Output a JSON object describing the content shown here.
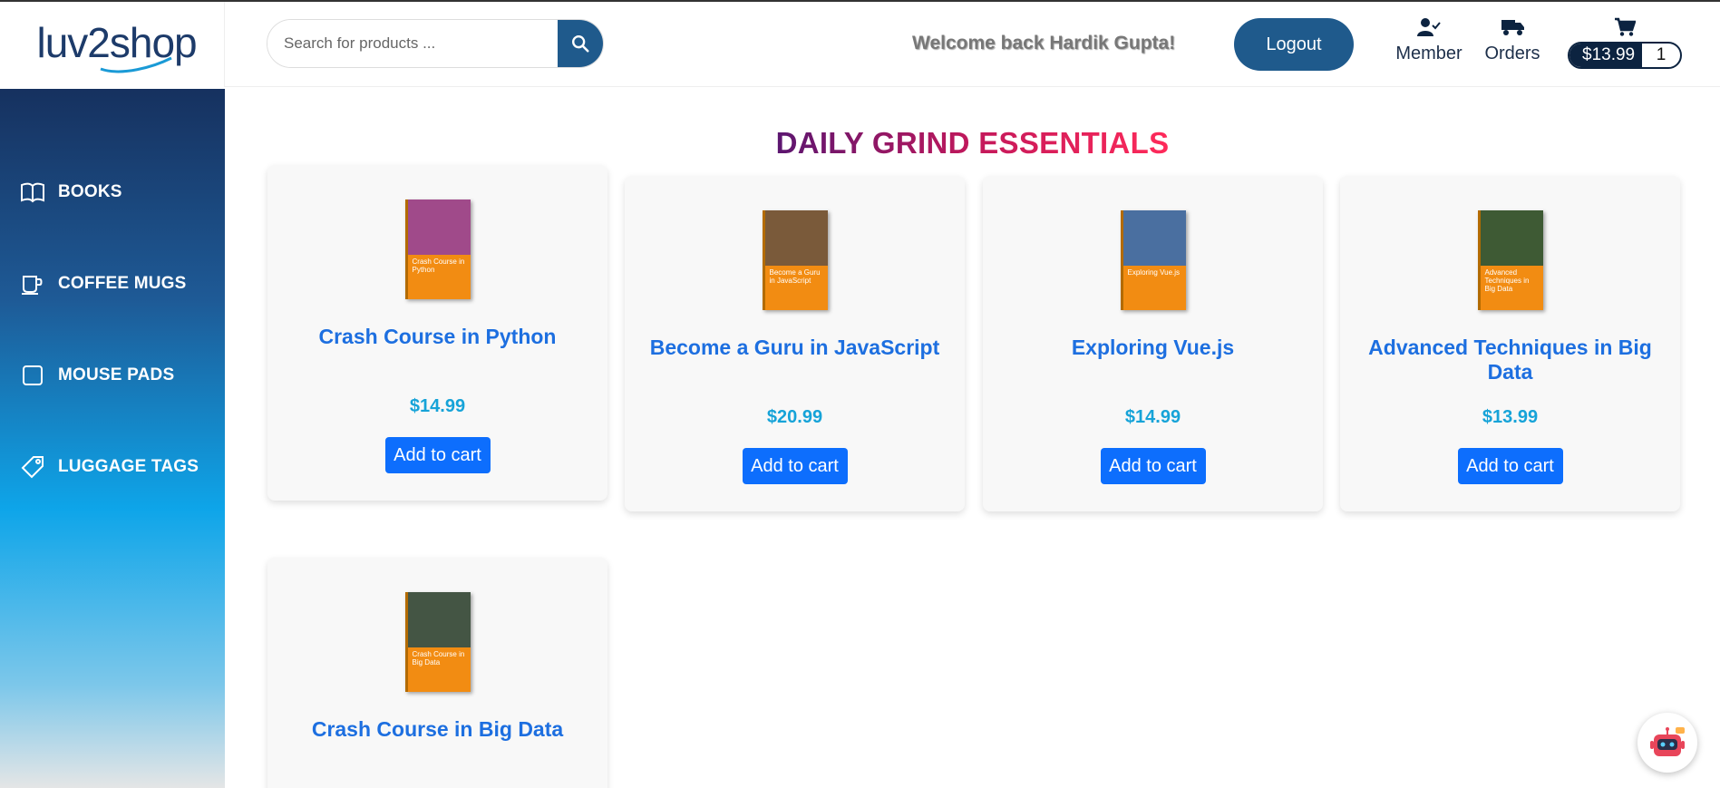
{
  "brand": {
    "logo_text": "luv2shop"
  },
  "search": {
    "placeholder": "Search for products ..."
  },
  "header": {
    "welcome": "Welcome back Hardik Gupta!",
    "logout_label": "Logout",
    "member_label": "Member",
    "orders_label": "Orders",
    "cart_total": "$13.99",
    "cart_count": "1"
  },
  "sidebar": {
    "items": [
      {
        "label": "BOOKS",
        "icon": "book-icon"
      },
      {
        "label": "COFFEE MUGS",
        "icon": "mug-icon"
      },
      {
        "label": "MOUSE PADS",
        "icon": "square-icon"
      },
      {
        "label": "LUGGAGE TAGS",
        "icon": "tag-icon"
      }
    ]
  },
  "main": {
    "title": "DAILY GRIND ESSENTIALS",
    "add_label": "Add to cart",
    "products": [
      {
        "name": "Crash Course in Python",
        "price": "$14.99",
        "cover_text": "Crash Course in Python",
        "cover_color": "#a04a8a"
      },
      {
        "name": "Become a Guru in JavaScript",
        "price": "$20.99",
        "cover_text": "Become a Guru in JavaScript",
        "cover_color": "#7a5a3a"
      },
      {
        "name": "Exploring Vue.js",
        "price": "$14.99",
        "cover_text": "Exploring Vue.js",
        "cover_color": "#4a6fa0"
      },
      {
        "name": "Advanced Techniques in Big Data",
        "price": "$13.99",
        "cover_text": "Advanced Techniques in Big Data",
        "cover_color": "#3e5a34"
      },
      {
        "name": "Crash Course in Big Data",
        "price": "",
        "cover_text": "Crash Course in Big Data",
        "cover_color": "#445544"
      }
    ]
  },
  "colors": {
    "accent": "#1f5a8c",
    "button": "#0d6efd",
    "link": "#1d6fe0",
    "price": "#16a3d8"
  }
}
